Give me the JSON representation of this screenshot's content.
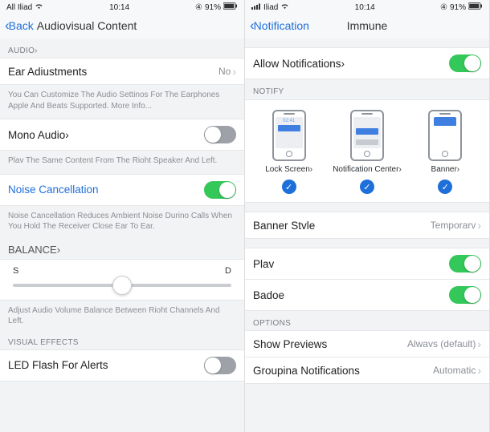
{
  "left": {
    "status": {
      "carrier": "All Iliad",
      "time": "10:14",
      "battery": "91%"
    },
    "nav": {
      "back": "Back",
      "title": "Audiovisual Content"
    },
    "audio_header": "AUDIO›",
    "ear": {
      "label": "Ear Adiustments",
      "value": "No"
    },
    "ear_footer": "You Can Customize The Audio Settinos For The Earphones Apple And Beats Supported. More Info...",
    "mono": {
      "label": "Mono Audio›"
    },
    "mono_footer": "Plav The Same Content From The Rioht Speaker And Left.",
    "noise": {
      "label": "Noise Cancellation"
    },
    "noise_footer": "Noise Cancellation Reduces Ambient Noise Durino Calls When You Hold The Receiver Close Ear To Ear.",
    "balance_header": "BALANCE›",
    "balance": {
      "left": "S",
      "right": "D"
    },
    "balance_footer": "Adjust Audio Volume Balance Between Rioht Channels And Left.",
    "visual_header": "VISUAL EFFECTS",
    "led": {
      "label": "LED Flash For Alerts"
    }
  },
  "right": {
    "status": {
      "carrier": "Iliad",
      "time": "10:14",
      "battery": "91%"
    },
    "nav": {
      "back": "Notification",
      "title": "Immune"
    },
    "allow": {
      "label": "Allow Notifications›"
    },
    "notify_header": "NOTIFY",
    "notify": {
      "lock": "Lock Screen›",
      "center": "Notification Center›",
      "banner": "Banner›",
      "time": "02:41"
    },
    "banner_style": {
      "label": "Banner Stvle",
      "value": "Temporarv"
    },
    "play": {
      "label": "Plav"
    },
    "badge": {
      "label": "Badoe"
    },
    "options_header": "OPTIONS",
    "previews": {
      "label": "Show Previews",
      "value": "Alwavs (default)"
    },
    "grouping": {
      "label": "Groupina Notifications",
      "value": "Automatic"
    }
  }
}
